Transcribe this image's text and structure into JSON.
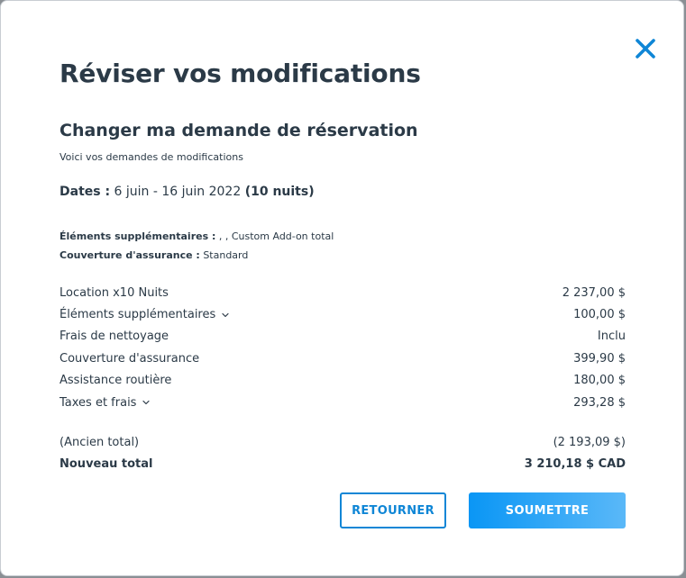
{
  "modal": {
    "title": "Réviser vos modifications",
    "close_icon": "close-icon",
    "subtitle": "Changer ma demande de réservation",
    "description": "Voici vos demandes de modifications",
    "dates": {
      "label": "Dates :",
      "range": "6 juin - 16 juin 2022",
      "nights": "(10 nuits)"
    },
    "extras": {
      "label": "Éléments supplémentaires :",
      "value": ", , Custom Add-on total"
    },
    "insurance": {
      "label": "Couverture d'assurance :",
      "value": "Standard"
    },
    "line_items": [
      {
        "label": "Location x10 Nuits",
        "amount": "2 237,00 $"
      },
      {
        "label": "Éléments supplémentaires",
        "amount": "100,00 $"
      },
      {
        "label": "Frais de nettoyage",
        "amount": "Inclu"
      },
      {
        "label": "Couverture d'assurance",
        "amount": "399,90 $"
      },
      {
        "label": "Assistance routière",
        "amount": "180,00 $"
      },
      {
        "label": "Taxes et frais",
        "amount": "293,28 $"
      }
    ],
    "old_total": {
      "label": "(Ancien total)",
      "amount": "(2 193,09 $)"
    },
    "new_total": {
      "label": "Nouveau total",
      "amount": "3 210,18 $ CAD"
    },
    "buttons": {
      "back": "RETOURNER",
      "submit": "SOUMETTRE"
    },
    "colors": {
      "accent": "#0f86d6",
      "text": "#2b3a47"
    }
  }
}
